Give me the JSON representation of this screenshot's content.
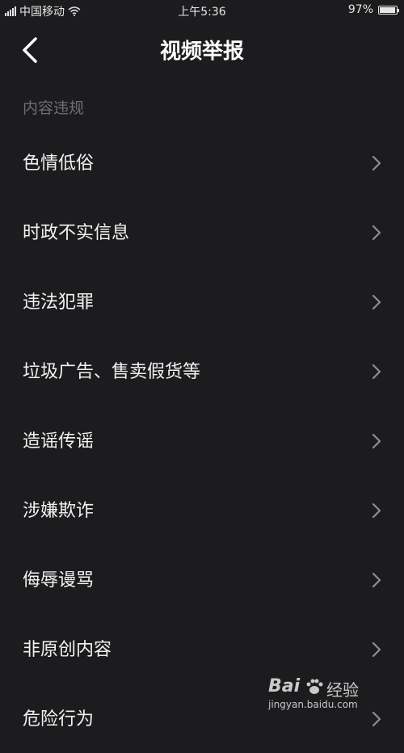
{
  "status_bar": {
    "carrier": "中国移动",
    "time": "上午5:36",
    "battery_percent": "97%",
    "battery_level": 0.97
  },
  "nav": {
    "title": "视频举报",
    "back_icon": "chevron-left-icon"
  },
  "section": {
    "header": "内容违规"
  },
  "items": [
    {
      "label": "色情低俗"
    },
    {
      "label": "时政不实信息"
    },
    {
      "label": "违法犯罪"
    },
    {
      "label": "垃圾广告、售卖假货等"
    },
    {
      "label": "造谣传谣"
    },
    {
      "label": "涉嫌欺诈"
    },
    {
      "label": "侮辱谩骂"
    },
    {
      "label": "非原创内容"
    },
    {
      "label": "危险行为"
    }
  ],
  "watermark": {
    "logo": "Bai",
    "brand": "经验",
    "url": "jingyan.baidu.com"
  },
  "colors": {
    "background": "#1c1c1e",
    "text": "#f2f2f2",
    "section_header": "#6e6e70",
    "chevron": "#8e8e93"
  }
}
